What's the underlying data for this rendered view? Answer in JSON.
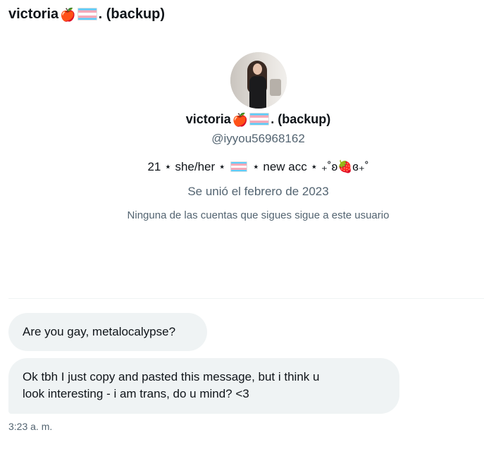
{
  "header": {
    "name_text": "victoria",
    "apple_glyph": "🍎",
    "suffix_text": ". (backup)"
  },
  "profile": {
    "display_name_text": "victoria",
    "apple_glyph": "🍎",
    "display_suffix_text": ". (backup)",
    "handle": "@iyyou56968162",
    "bio_part1": "21 ⋆ she/her ⋆",
    "bio_part2": "⋆ new acc ⋆ ₊˚ʚ🍓ɞ₊˚",
    "joined": "Se unió el febrero de 2023",
    "followers_note": "Ninguna de las cuentas que sigues sigue a este usuario"
  },
  "messages": [
    {
      "text": "Are you gay, metalocalypse?"
    },
    {
      "line1": "Ok tbh I just copy and pasted this message, but i think u",
      "line2": "look interesting - i am trans, do u mind? <3"
    }
  ],
  "timestamp": "3:23 a. m.",
  "colors": {
    "text": "#0f1419",
    "secondary_text": "#536471",
    "bubble_bg": "#eff3f4",
    "trans_flag_blue": "#5bcefa",
    "trans_flag_pink": "#f5a9b8",
    "trans_flag_white": "#ffffff"
  },
  "icons": {
    "avatar": "profile-photo",
    "flag": "transgender-flag-emoji"
  }
}
